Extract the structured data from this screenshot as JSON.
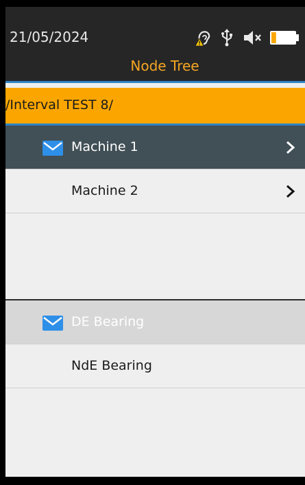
{
  "status": {
    "date": "21/05/2024",
    "title": "Node Tree",
    "icons": [
      "ear-warning-icon",
      "usb-icon",
      "speaker-muted-icon",
      "battery-icon"
    ],
    "battery_level": 0.2
  },
  "path": {
    "text": "/Interval TEST 8/"
  },
  "machines": [
    {
      "label": "Machine 1",
      "selected": true,
      "has_message": true
    },
    {
      "label": "Machine 2",
      "selected": false,
      "has_message": false
    }
  ],
  "points": [
    {
      "label": "DE Bearing",
      "selected": true,
      "has_message": true
    },
    {
      "label": "NdE Bearing",
      "selected": false,
      "has_message": false
    }
  ],
  "colors": {
    "accent": "#fba600",
    "header_bg": "#262626",
    "selected_row": "#414f56",
    "message_icon": "#2e8fe8"
  }
}
